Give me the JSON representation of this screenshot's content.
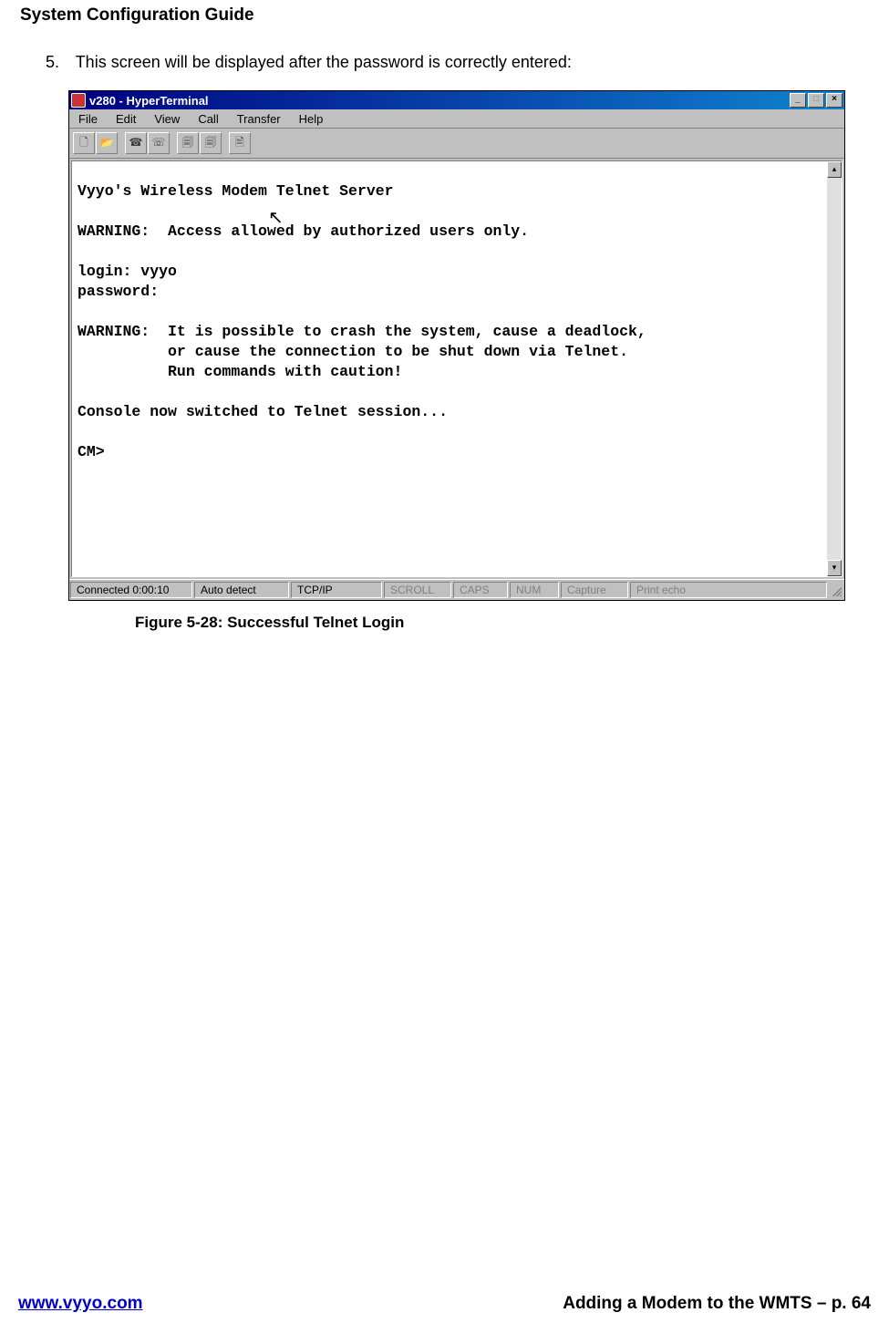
{
  "header": "System Configuration Guide",
  "step": {
    "num": "5.",
    "text": "This screen will be displayed after the password is correctly entered:"
  },
  "window": {
    "title": "v280 - HyperTerminal",
    "btn_min": "_",
    "btn_max": "□",
    "btn_close": "×",
    "menu": [
      "File",
      "Edit",
      "View",
      "Call",
      "Transfer",
      "Help"
    ],
    "terminal_text": "Vyyo's Wireless Modem Telnet Server\n\nWARNING:  Access allowed by authorized users only.\n\nlogin: vyyo\npassword:\n\nWARNING:  It is possible to crash the system, cause a deadlock,\n          or cause the connection to be shut down via Telnet.\n          Run commands with caution!\n\nConsole now switched to Telnet session...\n\nCM>",
    "status": {
      "connected": "Connected 0:00:10",
      "detect": "Auto detect",
      "proto": "TCP/IP",
      "scroll": "SCROLL",
      "caps": "CAPS",
      "num": "NUM",
      "capture": "Capture",
      "echo": "Print echo"
    },
    "scroll_up": "▴",
    "scroll_down": "▾"
  },
  "caption": "Figure 5-28: Successful Telnet Login",
  "footer": {
    "left": "www.vyyo.com",
    "right": "Adding a Modem to the WMTS – p. 64"
  }
}
